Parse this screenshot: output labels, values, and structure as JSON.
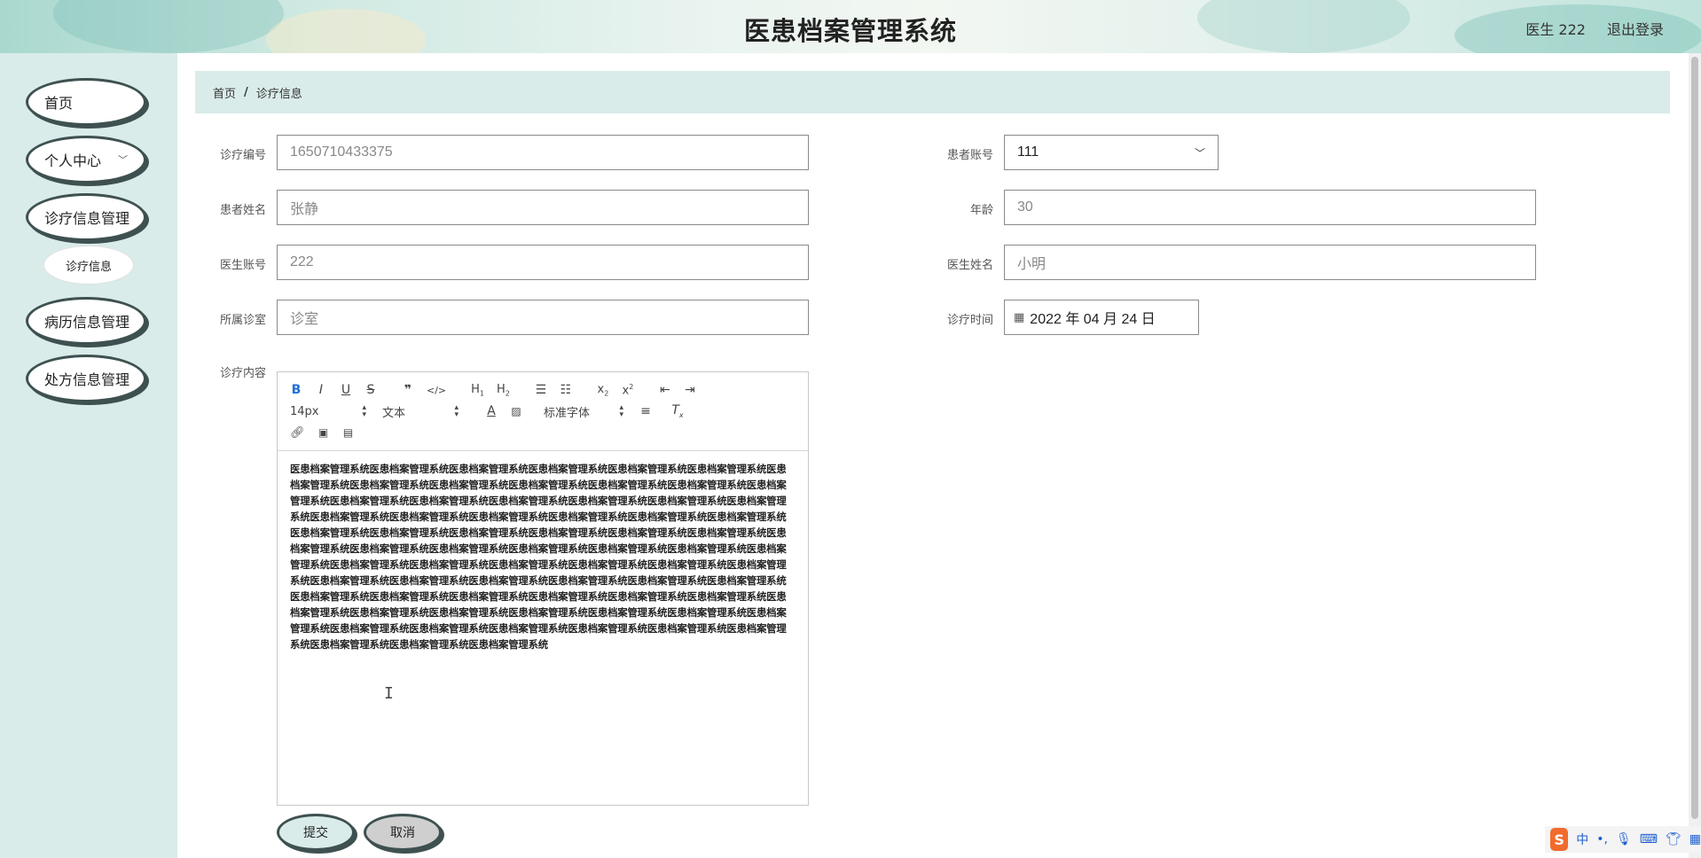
{
  "header": {
    "title": "医患档案管理系统",
    "user": "医生 222",
    "logout": "退出登录"
  },
  "sidebar": {
    "items": [
      {
        "label": "首页"
      },
      {
        "label": "个人中心"
      },
      {
        "label": "诊疗信息管理"
      },
      {
        "label": "诊疗信息"
      },
      {
        "label": "病历信息管理"
      },
      {
        "label": "处方信息管理"
      }
    ]
  },
  "breadcrumb": {
    "home": "首页",
    "separator": "/",
    "current": "诊疗信息"
  },
  "form": {
    "visit_no": {
      "label": "诊疗编号",
      "value": "1650710433375"
    },
    "patient_account": {
      "label": "患者账号",
      "value": "111"
    },
    "patient_name": {
      "label": "患者姓名",
      "value": "张静"
    },
    "age": {
      "label": "年龄",
      "value": "30"
    },
    "doctor_account": {
      "label": "医生账号",
      "value": "222"
    },
    "doctor_name": {
      "label": "医生姓名",
      "value": "小明"
    },
    "clinic": {
      "label": "所属诊室",
      "value": "诊室"
    },
    "visit_time": {
      "label": "诊疗时间",
      "value": "2022 年 04 月 24 日"
    },
    "content": {
      "label": "诊疗内容"
    }
  },
  "editor": {
    "font_size": "14px",
    "header_select": "文本",
    "font_family": "标准字体",
    "content": "医患档案管理系统医患档案管理系统医患档案管理系统医患档案管理系统医患档案管理系统医患档案管理系统医患档案管理系统医患档案管理系统医患档案管理系统医患档案管理系统医患档案管理系统医患档案管理系统医患档案管理系统医患档案管理系统医患档案管理系统医患档案管理系统医患档案管理系统医患档案管理系统医患档案管理系统医患档案管理系统医患档案管理系统医患档案管理系统医患档案管理系统医患档案管理系统医患档案管理系统医患档案管理系统医患档案管理系统医患档案管理系统医患档案管理系统医患档案管理系统医患档案管理系统医患档案管理系统医患档案管理系统医患档案管理系统医患档案管理系统医患档案管理系统医患档案管理系统医患档案管理系统医患档案管理系统医患档案管理系统医患档案管理系统医患档案管理系统医患档案管理系统医患档案管理系统医患档案管理系统医患档案管理系统医患档案管理系统医患档案管理系统医患档案管理系统医患档案管理系统医患档案管理系统医患档案管理系统医患档案管理系统医患档案管理系统医患档案管理系统医患档案管理系统医患档案管理系统医患档案管理系统医患档案管理系统医患档案管理系统医患档案管理系统医患档案管理系统医患档案管理系统医患档案管理系统医患档案管理系统医患档案管理系统医患档案管理系统医患档案管理系统医患档案管理系统医患档案管理系统医患档案管理系统医患档案管理系统"
  },
  "actions": {
    "submit": "提交",
    "cancel": "取消"
  },
  "ime": {
    "logo": "S",
    "lang": "中",
    "punct": "•,"
  }
}
